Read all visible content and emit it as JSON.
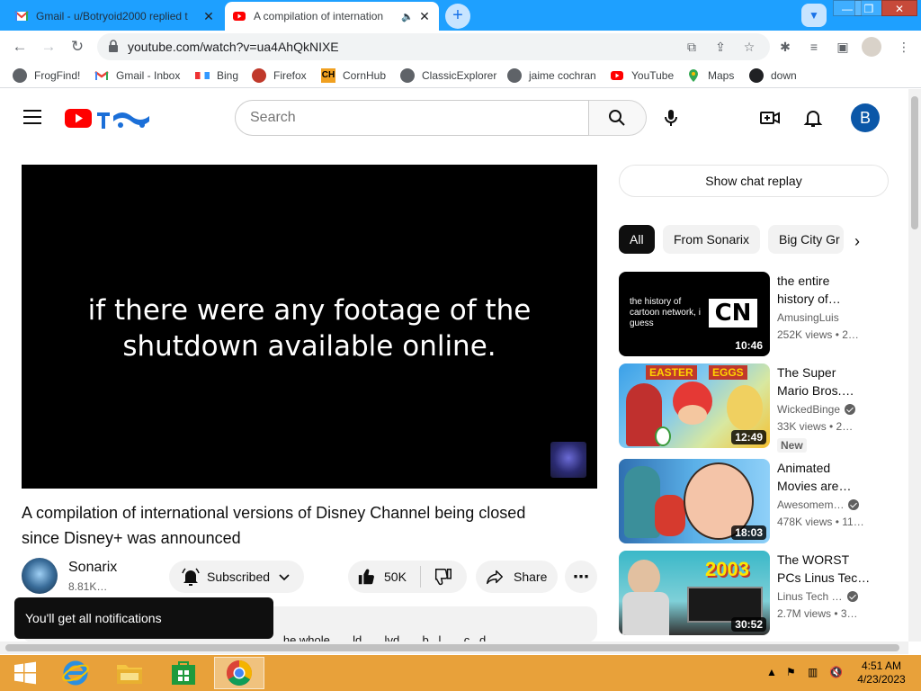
{
  "browser": {
    "tabs": [
      {
        "title": "Gmail - u/Botryoid2000 replied t",
        "active": false,
        "favicon": "gmail-icon"
      },
      {
        "title": "A compilation of internation",
        "active": true,
        "favicon": "youtube-icon"
      }
    ],
    "new_tab_symbol": "+",
    "window_controls": {
      "minimize": "—",
      "restore": "❒",
      "close": "✕"
    },
    "url": "youtube.com/watch?v=ua4AhQkNIXE",
    "bookmarks": [
      "FrogFind!",
      "Gmail - Inbox",
      "Bing",
      "Firefox",
      "CornHub",
      "ClassicExplorer",
      "jaime cochran",
      "YouTube",
      "Maps",
      "down"
    ]
  },
  "youtube": {
    "search_placeholder": "Search",
    "avatar_letter": "B",
    "player": {
      "caption_line1": "if there were any footage of the",
      "caption_line2": "shutdown available online."
    },
    "video": {
      "title_line1": "A compilation of international versions of Disney Channel being closed",
      "title_line2": "since Disney+ was announced",
      "channel": "Sonarix",
      "subscribers": "8.81K…",
      "subscribe_label": "Subscribed",
      "likes": "50K",
      "share_label": "Share",
      "more": "⋯",
      "description_snippet": "...he whole... ...ld... ...lvd... ...b...l... ...c...d..."
    },
    "toast": "You'll get all notifications",
    "chat_replay": "Show chat replay",
    "chips": [
      "All",
      "From Sonarix",
      "Big City Gr"
    ],
    "recommendations": [
      {
        "title_l1": "the entire",
        "title_l2": "history of…",
        "channel": "AmusingLuis",
        "verified": false,
        "meta": "252K views  • 2…",
        "duration": "10:46",
        "new": false,
        "thumb_text": "the history of cartoon network, i guess",
        "thumb_logo": "CN"
      },
      {
        "title_l1": "The Super",
        "title_l2": "Mario Bros.…",
        "channel": "WickedBinge",
        "verified": true,
        "meta": "33K views  • 2…",
        "duration": "12:49",
        "new": true,
        "new_label": "New",
        "thumb_text_a": "EASTER",
        "thumb_text_b": "EGGS"
      },
      {
        "title_l1": "Animated",
        "title_l2": "Movies are…",
        "channel": "Awesomem…",
        "verified": true,
        "meta": "478K views  • 11…",
        "duration": "18:03",
        "new": false
      },
      {
        "title_l1": "The WORST",
        "title_l2": "PCs Linus Tec…",
        "channel": "Linus Tech …",
        "verified": true,
        "meta": "2.7M views  • 3…",
        "duration": "30:52",
        "new": false,
        "thumb_text": "2003"
      }
    ]
  },
  "taskbar": {
    "time": "4:51 AM",
    "date": "4/23/2023",
    "apps": [
      "start",
      "internet-explorer",
      "file-explorer",
      "store",
      "chrome"
    ]
  },
  "colors": {
    "tabstrip": "#1ea0ff",
    "youtube_red": "#ff0000",
    "taskbar": "#e8a13a",
    "avatar": "#0b57a8"
  }
}
